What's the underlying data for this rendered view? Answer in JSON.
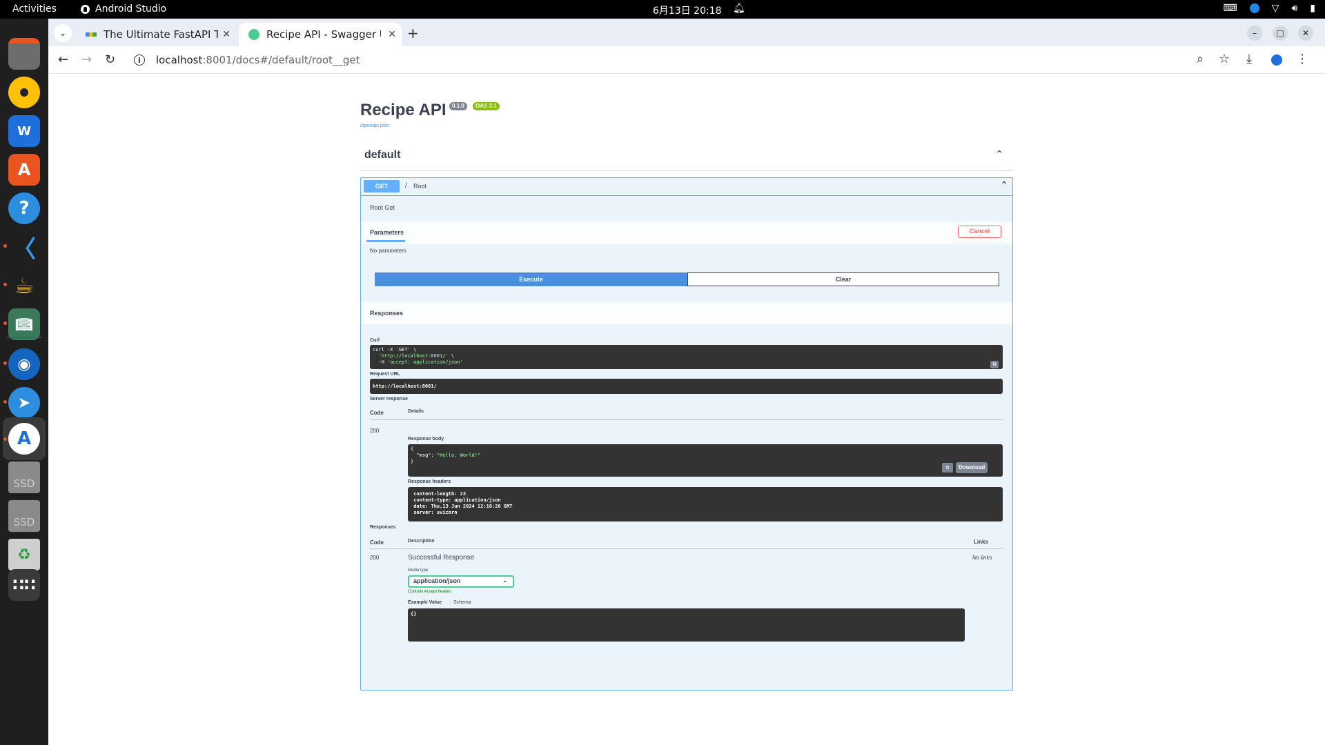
{
  "topbar": {
    "activities": "Activities",
    "app_name": "Android Studio",
    "clock": "6月13日  20:18"
  },
  "dock": {
    "items": [
      {
        "name": "files-icon"
      },
      {
        "name": "rhythmbox-icon"
      },
      {
        "name": "writer-icon"
      },
      {
        "name": "app-center-icon"
      },
      {
        "name": "help-icon"
      },
      {
        "name": "vscode-icon"
      },
      {
        "name": "jupyter-icon"
      },
      {
        "name": "book-icon"
      },
      {
        "name": "globe-icon"
      },
      {
        "name": "feishu-icon"
      },
      {
        "name": "android-studio-icon"
      },
      {
        "name": "ssd-drive-icon",
        "label": "SSD"
      },
      {
        "name": "ssd-drive-icon",
        "label": "SSD"
      },
      {
        "name": "trash-icon"
      },
      {
        "name": "app-grid-icon"
      }
    ]
  },
  "browser": {
    "tabs": [
      {
        "title": "The Ultimate FastAPI Tu",
        "active": false
      },
      {
        "title": "Recipe API - Swagger UI",
        "active": true
      }
    ],
    "url_host": "localhost",
    "url_rest": ":8001/docs#/default/root__get"
  },
  "swagger": {
    "title": "Recipe API",
    "version": "0.1.0",
    "oas": "OAS 3.1",
    "openapi_link": "/openapi.json",
    "tag": "default",
    "operation": {
      "method": "GET",
      "path": "/",
      "summary": "Root",
      "description": "Root Get",
      "parameters_tab": "Parameters",
      "cancel": "Cancel",
      "no_params": "No parameters",
      "execute": "Execute",
      "clear": "Clear",
      "responses_heading": "Responses",
      "curl_label": "Curl",
      "curl_line1": "curl -X 'GET' \\",
      "curl_line2a": "  ",
      "curl_line2b": "'http://localhost:8001/'",
      "curl_line2c": " \\",
      "curl_line3a": "  -H ",
      "curl_line3b": "'accept: application/json'",
      "request_url_label": "Request URL",
      "request_url": "http://localhost:8001/",
      "server_response_label": "Server response",
      "col_code": "Code",
      "col_details": "Details",
      "status_code": "200",
      "response_body_label": "Response body",
      "body_open": "{",
      "body_key": "  \"msg\": ",
      "body_val": "\"Hello, World!\"",
      "body_close": "}",
      "download": "Download",
      "response_headers_label": "Response headers",
      "headers": [
        " content-length: 23",
        " content-type: application/json",
        " date: Thu,13 Jun 2024 12:16:26 GMT",
        " server: uvicorn"
      ],
      "responses_label": "Responses",
      "col_description": "Description",
      "col_links": "Links",
      "resp_code": "200",
      "resp_desc": "Successful Response",
      "no_links": "No links",
      "media_type_label": "Media type",
      "media_type": "application/json",
      "controls_accept": "Controls Accept header.",
      "example_value": "Example Value",
      "schema": "Schema",
      "example_body": "{}"
    }
  }
}
